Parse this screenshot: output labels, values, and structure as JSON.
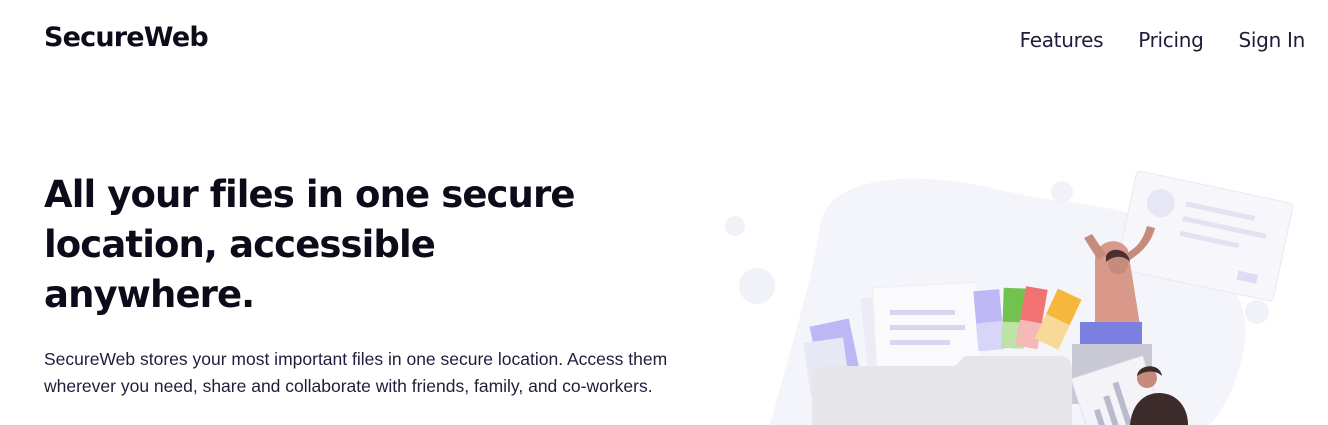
{
  "header": {
    "logo": "SecureWeb",
    "nav": [
      {
        "label": "Features"
      },
      {
        "label": "Pricing"
      },
      {
        "label": "Sign In"
      }
    ]
  },
  "hero": {
    "title": "All your files in one secure location, accessible anywhere.",
    "description": "SecureWeb stores your most important files in one secure location. Access them wherever you need, share and collaborate with friends, family, and co-workers."
  },
  "colors": {
    "text_dark": "#0b0b1a",
    "text_body": "#1e1e3c",
    "illustration_bg": "#f4f4fb",
    "folder": "#e6e6ea",
    "accent_purple": "#bdb7f5",
    "accent_green": "#72c24f",
    "accent_red": "#f07272",
    "accent_orange": "#f6b73c",
    "skin": "#c58c7e",
    "shirt": "#d9998a",
    "pants": "#7b7fe0"
  },
  "illustration": {
    "icon": "file-sharing-illustration"
  }
}
